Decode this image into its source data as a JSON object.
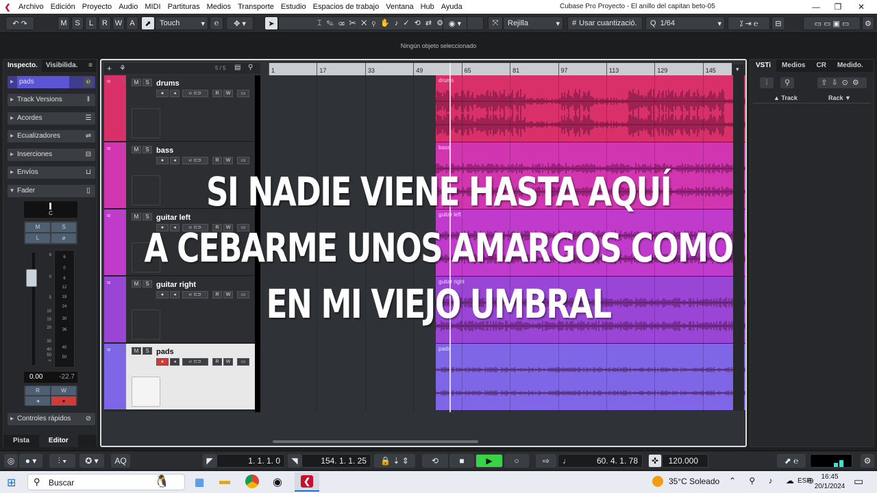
{
  "menu": {
    "items": [
      "Archivo",
      "Edición",
      "Proyecto",
      "Audio",
      "MIDI",
      "Partituras",
      "Medios",
      "Transporte",
      "Estudio",
      "Espacios de trabajo",
      "Ventana",
      "Hub",
      "Ayuda"
    ],
    "window_title": "Cubase Pro Proyecto - El anillo del capitan beto-05"
  },
  "toolbar": {
    "mode_buttons": [
      "M",
      "S",
      "L",
      "R",
      "W",
      "A"
    ],
    "automation_mode": "Touch",
    "snap_type": "Rejilla",
    "quantize_mode": "Usar cuantizació.",
    "quantize_value": "1/64"
  },
  "info_line": "Ningún objeto seleccionado",
  "inspector": {
    "tabs": [
      "Inspecto.",
      "Visibilida."
    ],
    "selected_track": "pads",
    "sections": [
      "Track Versions",
      "Acordes",
      "Ecualizadores",
      "Inserciones",
      "Envíos",
      "Fader"
    ],
    "pan_value": "C",
    "fader_scale": [
      "6",
      "0",
      "5",
      "10",
      "15",
      "20",
      "30",
      "40",
      "50",
      "∞"
    ],
    "meter_scale": [
      "6",
      "0",
      "6",
      "12",
      "18",
      "24",
      "30",
      "36",
      "40",
      "50"
    ],
    "volume": "0.00",
    "peak": "-22.7",
    "quick_controls": "Controles rápidos",
    "bottom_tabs": [
      "Pista",
      "Editor"
    ]
  },
  "tracklist": {
    "count": "5 / 5",
    "tracks": [
      {
        "name": "drums",
        "num": "1",
        "color": "#d9306a"
      },
      {
        "name": "bass",
        "num": "2",
        "color": "#d235b0"
      },
      {
        "name": "guitar left",
        "num": "3",
        "color": "#c03bcc"
      },
      {
        "name": "guitar right",
        "num": "4",
        "color": "#9a45d6"
      },
      {
        "name": "pads",
        "num": "5",
        "color": "#7e66e6"
      }
    ]
  },
  "ruler": {
    "marks": [
      "1",
      "17",
      "33",
      "49",
      "65",
      "81",
      "97",
      "113",
      "129",
      "145"
    ]
  },
  "right_zone": {
    "tabs": [
      "VSTi",
      "Medios",
      "CR",
      "Medido."
    ],
    "col_track": "Track",
    "col_rack": "Rack"
  },
  "transport": {
    "left_locator": "1. 1. 1.   0",
    "right_locator": "154. 1. 1. 25",
    "position": "60. 4. 1. 78",
    "tempo": "120.000",
    "aq": "AQ"
  },
  "lyrics": [
    "SI NADIE VIENE HASTA AQUÍ",
    "A CEBARME UNOS AMARGOS COMO",
    "EN MI VIEJO UMBRAL"
  ],
  "taskbar": {
    "search": "Buscar",
    "weather": "35°C  Soleado",
    "lang": "ESP",
    "time": "16:45",
    "date": "20/1/2024"
  }
}
